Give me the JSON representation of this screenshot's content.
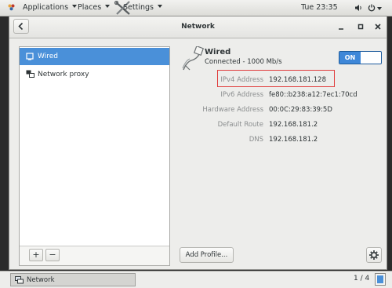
{
  "topbar": {
    "applications": "Applications",
    "places": "Places",
    "settings": "Settings",
    "clock": "Tue 23:35"
  },
  "window": {
    "title": "Network"
  },
  "sidebar": {
    "items": [
      {
        "label": "Wired",
        "icon": "wired-icon",
        "selected": true
      },
      {
        "label": "Network proxy",
        "icon": "proxy-icon",
        "selected": false
      }
    ],
    "add_label": "+",
    "remove_label": "−"
  },
  "connection": {
    "name": "Wired",
    "status": "Connected - 1000 Mb/s",
    "toggle_label": "ON",
    "toggle_on": true
  },
  "details": [
    {
      "label": "IPv4 Address",
      "value": "192.168.181.128"
    },
    {
      "label": "IPv6 Address",
      "value": "fe80::b238:a12:7ec1:70cd"
    },
    {
      "label": "Hardware Address",
      "value": "00:0C:29:83:39:5D"
    },
    {
      "label": "Default Route",
      "value": "192.168.181.2"
    },
    {
      "label": "DNS",
      "value": "192.168.181.2"
    }
  ],
  "buttons": {
    "add_profile": "Add Profile..."
  },
  "taskbar": {
    "item_label": "Network",
    "workspace": "1 / 4"
  },
  "colors": {
    "selection": "#4a90d9",
    "toggle_on": "#3e87d8",
    "highlight": "#e03b3b"
  }
}
